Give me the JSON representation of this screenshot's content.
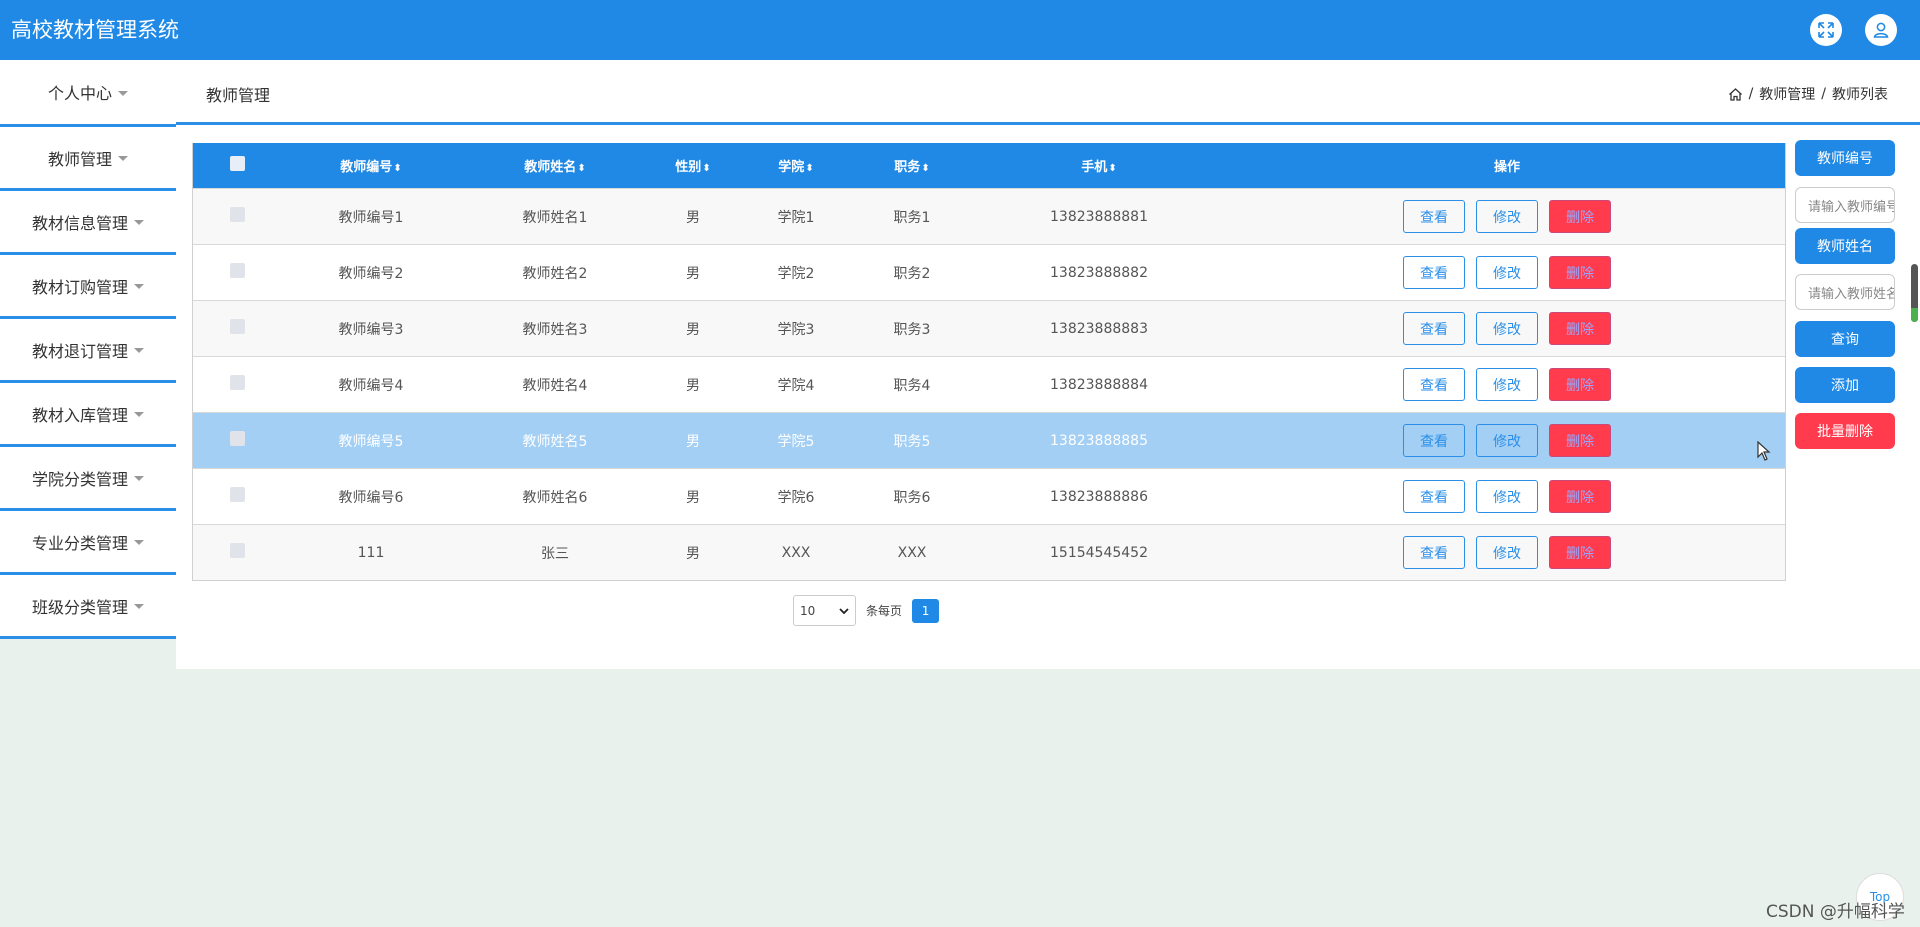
{
  "header": {
    "title": "高校教材管理系统",
    "icons": [
      "fullscreen-icon",
      "user-icon"
    ]
  },
  "colors": {
    "primary": "#1f89e5",
    "danger": "#ff3b4d",
    "highlight_row": "#a3cff5",
    "page_bg": "#e8f1ec"
  },
  "sidebar": {
    "items": [
      {
        "label": "个人中心"
      },
      {
        "label": "教师管理"
      },
      {
        "label": "教材信息管理"
      },
      {
        "label": "教材订购管理"
      },
      {
        "label": "教材退订管理"
      },
      {
        "label": "教材入库管理"
      },
      {
        "label": "学院分类管理"
      },
      {
        "label": "专业分类管理"
      },
      {
        "label": "班级分类管理"
      }
    ]
  },
  "page": {
    "heading": "教师管理",
    "breadcrumb": [
      "教师管理",
      "教师列表"
    ],
    "breadcrumb_sep": "/"
  },
  "table": {
    "columns": [
      "教师编号",
      "教师姓名",
      "性别",
      "学院",
      "职务",
      "手机",
      "操作"
    ],
    "sort_glyph": "⬍",
    "rows": [
      {
        "no": "教师编号1",
        "name": "教师姓名1",
        "sex": "男",
        "college": "学院1",
        "position": "职务1",
        "phone": "13823888881"
      },
      {
        "no": "教师编号2",
        "name": "教师姓名2",
        "sex": "男",
        "college": "学院2",
        "position": "职务2",
        "phone": "13823888882"
      },
      {
        "no": "教师编号3",
        "name": "教师姓名3",
        "sex": "男",
        "college": "学院3",
        "position": "职务3",
        "phone": "13823888883"
      },
      {
        "no": "教师编号4",
        "name": "教师姓名4",
        "sex": "男",
        "college": "学院4",
        "position": "职务4",
        "phone": "13823888884"
      },
      {
        "no": "教师编号5",
        "name": "教师姓名5",
        "sex": "男",
        "college": "学院5",
        "position": "职务5",
        "phone": "13823888885"
      },
      {
        "no": "教师编号6",
        "name": "教师姓名6",
        "sex": "男",
        "college": "学院6",
        "position": "职务6",
        "phone": "13823888886"
      },
      {
        "no": "111",
        "name": "张三",
        "sex": "男",
        "college": "XXX",
        "position": "XXX",
        "phone": "15154545452"
      }
    ],
    "actions": {
      "view": "查看",
      "edit": "修改",
      "delete": "删除"
    }
  },
  "pagination": {
    "page_size": "10",
    "per_page_label": "条每页",
    "current_page": "1"
  },
  "right_panel": {
    "teacher_no_label": "教师编号",
    "teacher_no_placeholder": "请输入教师编号",
    "teacher_name_label": "教师姓名",
    "teacher_name_placeholder": "请输入教师姓名",
    "search_button": "查询",
    "add_button": "添加",
    "batch_delete_button": "批量删除"
  },
  "top_button": "Top",
  "watermark": "CSDN @升幅科学"
}
